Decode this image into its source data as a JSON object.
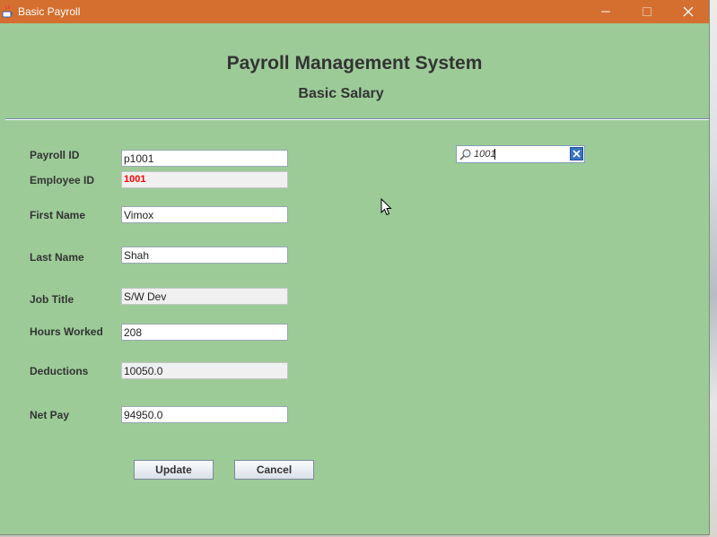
{
  "window": {
    "title": "Basic Payroll",
    "titlebar_color": "#d46f2f",
    "background_color": "#9ccb98",
    "controls": [
      "minimize-icon",
      "maximize-icon",
      "close-icon"
    ]
  },
  "header": {
    "title": "Payroll Management System",
    "subtitle": "Basic Salary"
  },
  "form": {
    "payroll_id": {
      "label": "Payroll  ID",
      "value": "p1001"
    },
    "employee_id": {
      "label": "Employee ID",
      "value": "1001",
      "value_color": "#ff0000"
    },
    "first_name": {
      "label": "First Name",
      "value": "Vimox"
    },
    "last_name": {
      "label": "Last Name",
      "value": "Shah"
    },
    "job_title": {
      "label": "Job Title",
      "value": "S/W Dev"
    },
    "hours_worked": {
      "label": "Hours Worked",
      "value": "208"
    },
    "deductions": {
      "label": "Deductions",
      "value": "10050.0"
    },
    "net_pay": {
      "label": "Net Pay",
      "value": "94950.0"
    }
  },
  "search": {
    "value": "1001",
    "icon": "search-icon",
    "clear_icon": "clear-icon"
  },
  "buttons": {
    "update": "Update",
    "cancel": "Cancel"
  }
}
